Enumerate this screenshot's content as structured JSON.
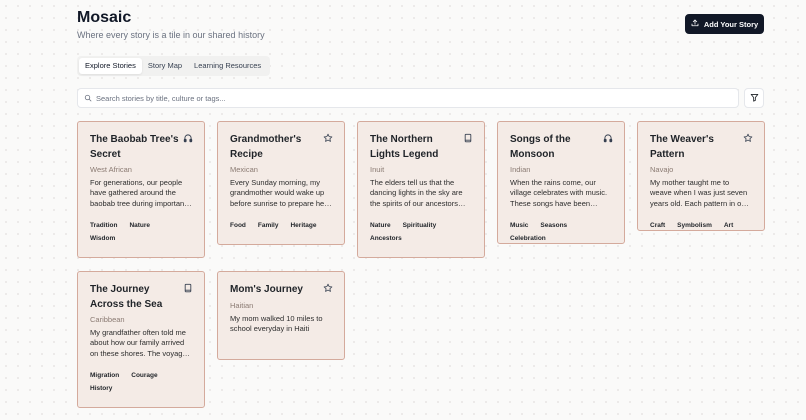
{
  "header": {
    "title": "Mosaic",
    "subtitle": "Where every story is a tile in our shared history",
    "add_button_label": "Add Your Story"
  },
  "tabs": [
    {
      "label": "Explore Stories",
      "active": true
    },
    {
      "label": "Story Map",
      "active": false
    },
    {
      "label": "Learning Resources",
      "active": false
    }
  ],
  "search": {
    "placeholder": "Search stories by title, culture or tags..."
  },
  "colors": {
    "card_bg": "#f4ebe6",
    "card_border": "#d4aa9c",
    "button_bg": "#111827"
  },
  "stories": [
    {
      "title": "The Baobab Tree's Secret",
      "culture": "West African",
      "excerpt": "For generations, our people have gathered around the baobab tree during important moments.",
      "icon": "headphones-icon",
      "tags": [
        "Tradition",
        "Nature",
        "Wisdom"
      ]
    },
    {
      "title": "Grandmother's Recipe",
      "culture": "Mexican",
      "excerpt": "Every Sunday morning, my grandmother would wake up before sunrise to prepare her famous mole.",
      "icon": "star-icon",
      "tags": [
        "Food",
        "Family",
        "Heritage"
      ]
    },
    {
      "title": "The Northern Lights Legend",
      "culture": "Inuit",
      "excerpt": "The elders tell us that the dancing lights in the sky are the spirits of our ancestors playing.",
      "icon": "book-icon",
      "tags": [
        "Nature",
        "Spirituality",
        "Ancestors"
      ]
    },
    {
      "title": "Songs of the Monsoon",
      "culture": "Indian",
      "excerpt": "When the rains come, our village celebrates with music. These songs have been passed down.",
      "icon": "headphones-icon",
      "tags": [
        "Music",
        "Seasons",
        "Celebration"
      ]
    },
    {
      "title": "The Weaver's Pattern",
      "culture": "Navajo",
      "excerpt": "My mother taught me to weave when I was just seven years old. Each pattern in our rugs tells a story.",
      "icon": "star-icon",
      "tags": [
        "Craft",
        "Symbolism",
        "Art"
      ]
    },
    {
      "title": "The Journey Across the Sea",
      "culture": "Caribbean",
      "excerpt": "My grandfather often told me about how our family arrived on these shores. The voyage was long.",
      "icon": "book-icon",
      "tags": [
        "Migration",
        "Courage",
        "History"
      ]
    },
    {
      "title": "Mom's Journey",
      "culture": "Haitian",
      "excerpt": "My mom walked 10 miles to school everyday in Haiti",
      "icon": "star-icon",
      "tags": []
    }
  ]
}
